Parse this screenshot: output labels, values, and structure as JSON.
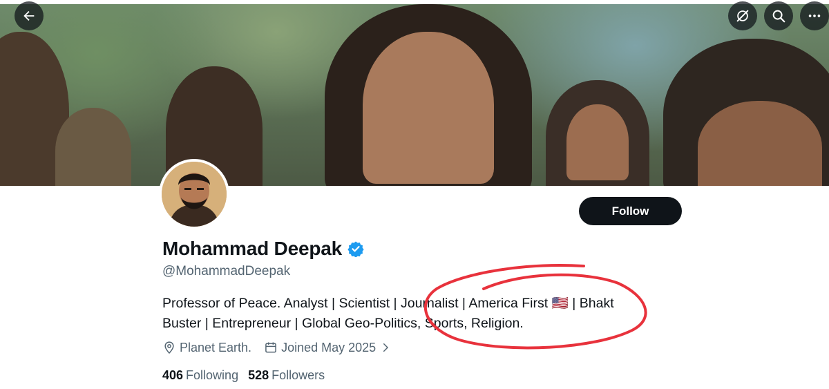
{
  "profile": {
    "display_name": "Mohammad Deepak",
    "handle": "@MohammadDeepak",
    "verified": true,
    "bio_line_1": "Professor of Peace. Analyst | Scientist | Journalist | America First 🇺🇸 | Bhakt",
    "bio_line_2": "Buster | Entrepreneur | Global Geo-Politics, Sports, Religion.",
    "location": "Planet Earth.",
    "joined": "Joined May 2025",
    "following_count": "406",
    "following_label": "Following",
    "followers_count": "528",
    "followers_label": "Followers"
  },
  "actions": {
    "follow_label": "Follow"
  },
  "icons": {
    "back": "arrow-left-icon",
    "grok": "grok-icon",
    "search": "search-icon",
    "more": "more-horizontal-icon",
    "verified": "verified-badge-icon",
    "location": "location-pin-icon",
    "calendar": "calendar-icon",
    "chevron": "chevron-right-icon"
  },
  "colors": {
    "primary_text": "#0f1419",
    "secondary_text": "#536471",
    "follow_button": "#0f1419",
    "verified_blue": "#1d9bf0",
    "annotation_red": "#e8323c"
  }
}
